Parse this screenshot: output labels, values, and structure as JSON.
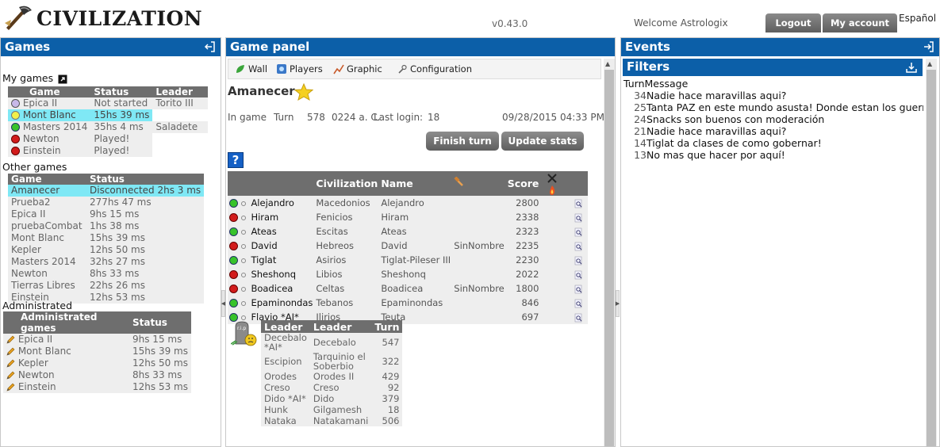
{
  "header": {
    "logo_text": "CIVILIZATION",
    "version": "v0.43.0",
    "welcome": "Welcome Astrologix",
    "logout": "Logout",
    "my_account": "My account",
    "language": "Español"
  },
  "games_panel": {
    "title": "Games",
    "my_games": {
      "label": "My games",
      "headers": [
        "Game",
        "Status",
        "Leader"
      ],
      "rows": [
        {
          "status_icon": "lavender-dot",
          "game": "Epica II",
          "status": "Not started",
          "leader": "Torito III"
        },
        {
          "status_icon": "yellow-dot",
          "game": "Mont Blanc",
          "status": "15hs 39 ms",
          "leader": ""
        },
        {
          "status_icon": "green-dot",
          "game": "Masters 2014",
          "status": "35hs 4 ms",
          "leader": "Saladete"
        },
        {
          "status_icon": "red-dot",
          "game": "Newton",
          "status": "Played!",
          "leader": ""
        },
        {
          "status_icon": "red-dot",
          "game": "Einstein",
          "status": "Played!",
          "leader": ""
        }
      ]
    },
    "other_games": {
      "label": "Other games",
      "headers": [
        "Game",
        "Status"
      ],
      "rows": [
        {
          "game": "Amanecer",
          "status": "Disconnected 2hs 3 ms"
        },
        {
          "game": "Prueba2",
          "status": "277hs 47 ms"
        },
        {
          "game": "Epica II",
          "status": "9hs 15 ms"
        },
        {
          "game": "pruebaCombat",
          "status": "1hs 38 ms"
        },
        {
          "game": "Mont Blanc",
          "status": "15hs 39 ms"
        },
        {
          "game": "Kepler",
          "status": "12hs 50 ms"
        },
        {
          "game": "Masters 2014",
          "status": "32hs 27 ms"
        },
        {
          "game": "Newton",
          "status": "8hs 33 ms"
        },
        {
          "game": "Tierras Libres",
          "status": "22hs 26 ms"
        },
        {
          "game": "Einstein",
          "status": "12hs 53 ms"
        }
      ]
    },
    "administrated": {
      "label": "Administrated",
      "headers": [
        "Administrated games",
        "Status"
      ],
      "rows": [
        {
          "game": "Epica II",
          "status": "9hs 15 ms"
        },
        {
          "game": "Mont Blanc",
          "status": "15hs 39 ms"
        },
        {
          "game": "Kepler",
          "status": "12hs 50 ms"
        },
        {
          "game": "Newton",
          "status": "8hs 33 ms"
        },
        {
          "game": "Einstein",
          "status": "12hs 53 ms"
        }
      ]
    }
  },
  "game_panel": {
    "title": "Game panel",
    "toolbar": [
      "Wall",
      "Players",
      "Graphic",
      "Configuration"
    ],
    "game_name": "Amanecer",
    "in_game": "In game",
    "turn_label": "Turn",
    "turn": "578",
    "year": "0224 a. C.",
    "last_login_label": "Last login:",
    "last_login": "18",
    "date": "09/28/2015 04:33 PM",
    "finish_turn": "Finish turn",
    "update_stats": "Update stats",
    "help": "?",
    "players_headers": {
      "civilization": "Civilization",
      "name": "Name",
      "score": "Score"
    },
    "players": [
      {
        "dot": "green",
        "leader": "Alejandro",
        "civ": "Macedonios",
        "name": "Alejandro",
        "extra": "",
        "score": "2800"
      },
      {
        "dot": "red",
        "leader": "Hiram",
        "civ": "Fenicios",
        "name": "Hiram",
        "extra": "",
        "score": "2338"
      },
      {
        "dot": "green",
        "leader": "Ateas",
        "civ": "Escitas",
        "name": "Ateas",
        "extra": "",
        "score": "2323"
      },
      {
        "dot": "red",
        "leader": "David",
        "civ": "Hebreos",
        "name": "David",
        "extra": "SinNombre",
        "score": "2235"
      },
      {
        "dot": "green",
        "leader": "Tiglat",
        "civ": "Asirios",
        "name": "Tiglat-Pileser III",
        "extra": "",
        "score": "2230"
      },
      {
        "dot": "red",
        "leader": "Sheshonq",
        "civ": "Libios",
        "name": "Sheshonq",
        "extra": "",
        "score": "2022"
      },
      {
        "dot": "red",
        "leader": "Boadicea",
        "civ": "Celtas",
        "name": "Boadicea",
        "extra": "SinNombre",
        "score": "1800"
      },
      {
        "dot": "green",
        "leader": "Epaminondas",
        "civ": "Tebanos",
        "name": "Epaminondas",
        "extra": "",
        "score": "846"
      },
      {
        "dot": "green",
        "leader": "Flavio *AI*",
        "civ": "Ilirios",
        "name": "Teuta",
        "extra": "",
        "score": "697"
      }
    ],
    "dead_headers": [
      "Leader",
      "Leader",
      "Turn"
    ],
    "dead": [
      {
        "a": "Decebalo *AI*",
        "b": "Decebalo",
        "turn": "547"
      },
      {
        "a": "Escipion",
        "b": "Tarquinio el Soberbio",
        "turn": "322"
      },
      {
        "a": "Orodes",
        "b": "Orodes II",
        "turn": "429"
      },
      {
        "a": "Creso",
        "b": "Creso",
        "turn": "92"
      },
      {
        "a": "Dido *AI*",
        "b": "Dido",
        "turn": "379"
      },
      {
        "a": "Hunk",
        "b": "Gilgamesh",
        "turn": "18"
      },
      {
        "a": "Nataka",
        "b": "Natakamani",
        "turn": "506"
      }
    ],
    "rip_text": "r.i.p"
  },
  "events_panel": {
    "title": "Events",
    "filters": "Filters",
    "col_turn": "Turn",
    "col_message": "Message",
    "events": [
      {
        "turn": "34",
        "message": "Nadie hace maravillas aqui?"
      },
      {
        "turn": "25",
        "message": "Tanta PAZ en este mundo asusta! Donde estan los guerreros"
      },
      {
        "turn": "24",
        "message": "Snacks son buenos con moderación"
      },
      {
        "turn": "21",
        "message": "Nadie hace maravillas aqui?"
      },
      {
        "turn": "14",
        "message": "Tiglat da clases de como gobernar!"
      },
      {
        "turn": "13",
        "message": "No mas que hacer por aquí!"
      }
    ]
  }
}
